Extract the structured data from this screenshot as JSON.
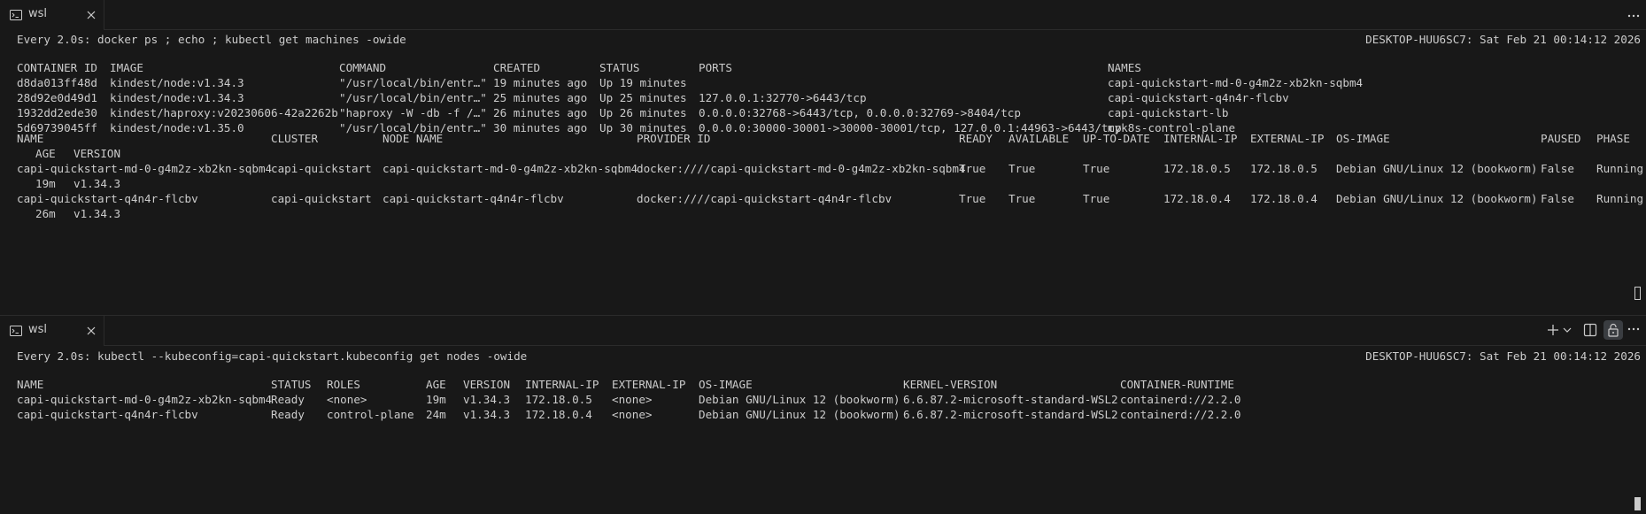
{
  "top_pane": {
    "tab": {
      "label": "wsl"
    },
    "header": {
      "command": "Every 2.0s: docker ps ; echo ; kubectl get machines -owide",
      "host_time": "DESKTOP-HUU6SC7: Sat Feb 21 00:14:12 2026"
    },
    "docker": {
      "headers": [
        "CONTAINER ID",
        "IMAGE",
        "COMMAND",
        "CREATED",
        "STATUS",
        "PORTS",
        "NAMES"
      ],
      "rows": [
        [
          "d8da013ff48d",
          "kindest/node:v1.34.3",
          "\"/usr/local/bin/entr…\"",
          "19 minutes ago",
          "Up 19 minutes",
          "",
          "capi-quickstart-md-0-g4m2z-xb2kn-sqbm4"
        ],
        [
          "28d92e0d49d1",
          "kindest/node:v1.34.3",
          "\"/usr/local/bin/entr…\"",
          "25 minutes ago",
          "Up 25 minutes",
          "127.0.0.1:32770->6443/tcp",
          "capi-quickstart-q4n4r-flcbv"
        ],
        [
          "1932dd2ede30",
          "kindest/haproxy:v20230606-42a2262b",
          "\"haproxy -W -db -f /…\"",
          "26 minutes ago",
          "Up 26 minutes",
          "0.0.0.0:32768->6443/tcp, 0.0.0.0:32769->8404/tcp",
          "capi-quickstart-lb"
        ],
        [
          "5d69739045ff",
          "kindest/node:v1.35.0",
          "\"/usr/local/bin/entr…\"",
          "30 minutes ago",
          "Up 30 minutes",
          "0.0.0.0:30000-30001->30000-30001/tcp, 127.0.0.1:44963->6443/tcp",
          "myk8s-control-plane"
        ]
      ]
    },
    "machines": {
      "headers": [
        "NAME",
        "CLUSTER",
        "NODE NAME",
        "PROVIDER ID",
        "READY",
        "AVAILABLE",
        "UP-TO-DATE",
        "INTERNAL-IP",
        "EXTERNAL-IP",
        "OS-IMAGE",
        "PAUSED",
        "PHASE"
      ],
      "headers_wrap": [
        "AGE",
        "VERSION"
      ],
      "rows": [
        {
          "cells": [
            "capi-quickstart-md-0-g4m2z-xb2kn-sqbm4",
            "capi-quickstart",
            "capi-quickstart-md-0-g4m2z-xb2kn-sqbm4",
            "docker:////capi-quickstart-md-0-g4m2z-xb2kn-sqbm4",
            "True",
            "True",
            "True",
            "172.18.0.5",
            "172.18.0.5",
            "Debian GNU/Linux 12 (bookworm)",
            "False",
            "Running"
          ],
          "wrap": [
            "19m",
            "v1.34.3"
          ]
        },
        {
          "cells": [
            "capi-quickstart-q4n4r-flcbv",
            "capi-quickstart",
            "capi-quickstart-q4n4r-flcbv",
            "docker:////capi-quickstart-q4n4r-flcbv",
            "True",
            "True",
            "True",
            "172.18.0.4",
            "172.18.0.4",
            "Debian GNU/Linux 12 (bookworm)",
            "False",
            "Running"
          ],
          "wrap": [
            "26m",
            "v1.34.3"
          ]
        }
      ]
    }
  },
  "bottom_pane": {
    "tab": {
      "label": "wsl"
    },
    "toolbar": {
      "icons": [
        "plus-icon",
        "chevron-down-icon",
        "split-editor-icon",
        "lock-icon",
        "more-icon"
      ]
    },
    "header": {
      "command": "Every 2.0s: kubectl --kubeconfig=capi-quickstart.kubeconfig get nodes -owide",
      "host_time": "DESKTOP-HUU6SC7: Sat Feb 21 00:14:12 2026"
    },
    "nodes": {
      "headers": [
        "NAME",
        "STATUS",
        "ROLES",
        "AGE",
        "VERSION",
        "INTERNAL-IP",
        "EXTERNAL-IP",
        "OS-IMAGE",
        "KERNEL-VERSION",
        "CONTAINER-RUNTIME"
      ],
      "rows": [
        [
          "capi-quickstart-md-0-g4m2z-xb2kn-sqbm4",
          "Ready",
          "<none>",
          "19m",
          "v1.34.3",
          "172.18.0.5",
          "<none>",
          "Debian GNU/Linux 12 (bookworm)",
          "6.6.87.2-microsoft-standard-WSL2",
          "containerd://2.2.0"
        ],
        [
          "capi-quickstart-q4n4r-flcbv",
          "Ready",
          "control-plane",
          "24m",
          "v1.34.3",
          "172.18.0.4",
          "<none>",
          "Debian GNU/Linux 12 (bookworm)",
          "6.6.87.2-microsoft-standard-WSL2",
          "containerd://2.2.0"
        ]
      ]
    }
  },
  "top_more_icon": "more-icon"
}
